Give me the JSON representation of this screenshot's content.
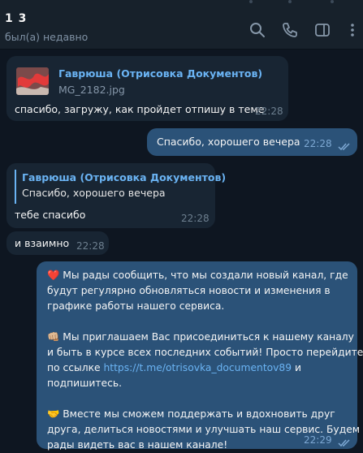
{
  "header": {
    "name": "1 3",
    "status": "был(а) недавно"
  },
  "messages": [
    {
      "reply_name": "Гаврюша (Отрисовка Документов)",
      "reply_file": "MG_2182.jpg",
      "text": "спасибо, загружу, как пройдет отпишу в теме",
      "time": "22:28"
    },
    {
      "text": "Спасибо, хорошего вечера",
      "time": "22:28"
    },
    {
      "reply_name": "Гаврюша (Отрисовка Документов)",
      "reply_text": "Спасибо, хорошего вечера",
      "text": "тебе спасибо",
      "time": "22:28"
    },
    {
      "text": "и взаимно",
      "time": "22:28"
    },
    {
      "p1": {
        "emoji": "❤️",
        "line1": "Мы рады сообщить, что мы создали новый канал, где",
        "line2": "будут регулярно обновляться новости и изменения в",
        "line3": "графике работы нашего сервиса."
      },
      "p2": {
        "emoji": "👊🏼",
        "line1": "Мы приглашаем Вас присоединиться к нашему каналу",
        "line2": "и быть в курсе всех последних событий! Просто перейдите",
        "line3_pre": "по ссылке",
        "link": "https://t.me/otrisovka_documentov89",
        "line3_post": "и",
        "line4": "подпишитесь."
      },
      "p3": {
        "emoji": "🤝",
        "line1": "Вместе мы сможем поддержать и вдохновить друг",
        "line2": "друга, делиться новостями и улучшать наш сервис. Будем",
        "line3": "рады видеть вас в нашем канале!"
      },
      "time": "22:29"
    }
  ],
  "icons": [
    "search-icon",
    "phone-icon",
    "sidebar-toggle-icon",
    "more-icon",
    "read-check-icon"
  ],
  "colors": {
    "background": "#0e1621",
    "header": "#17212b",
    "incoming_bubble": "#182533",
    "outgoing_bubble": "#2b5278",
    "accent": "#6ab3f3"
  }
}
